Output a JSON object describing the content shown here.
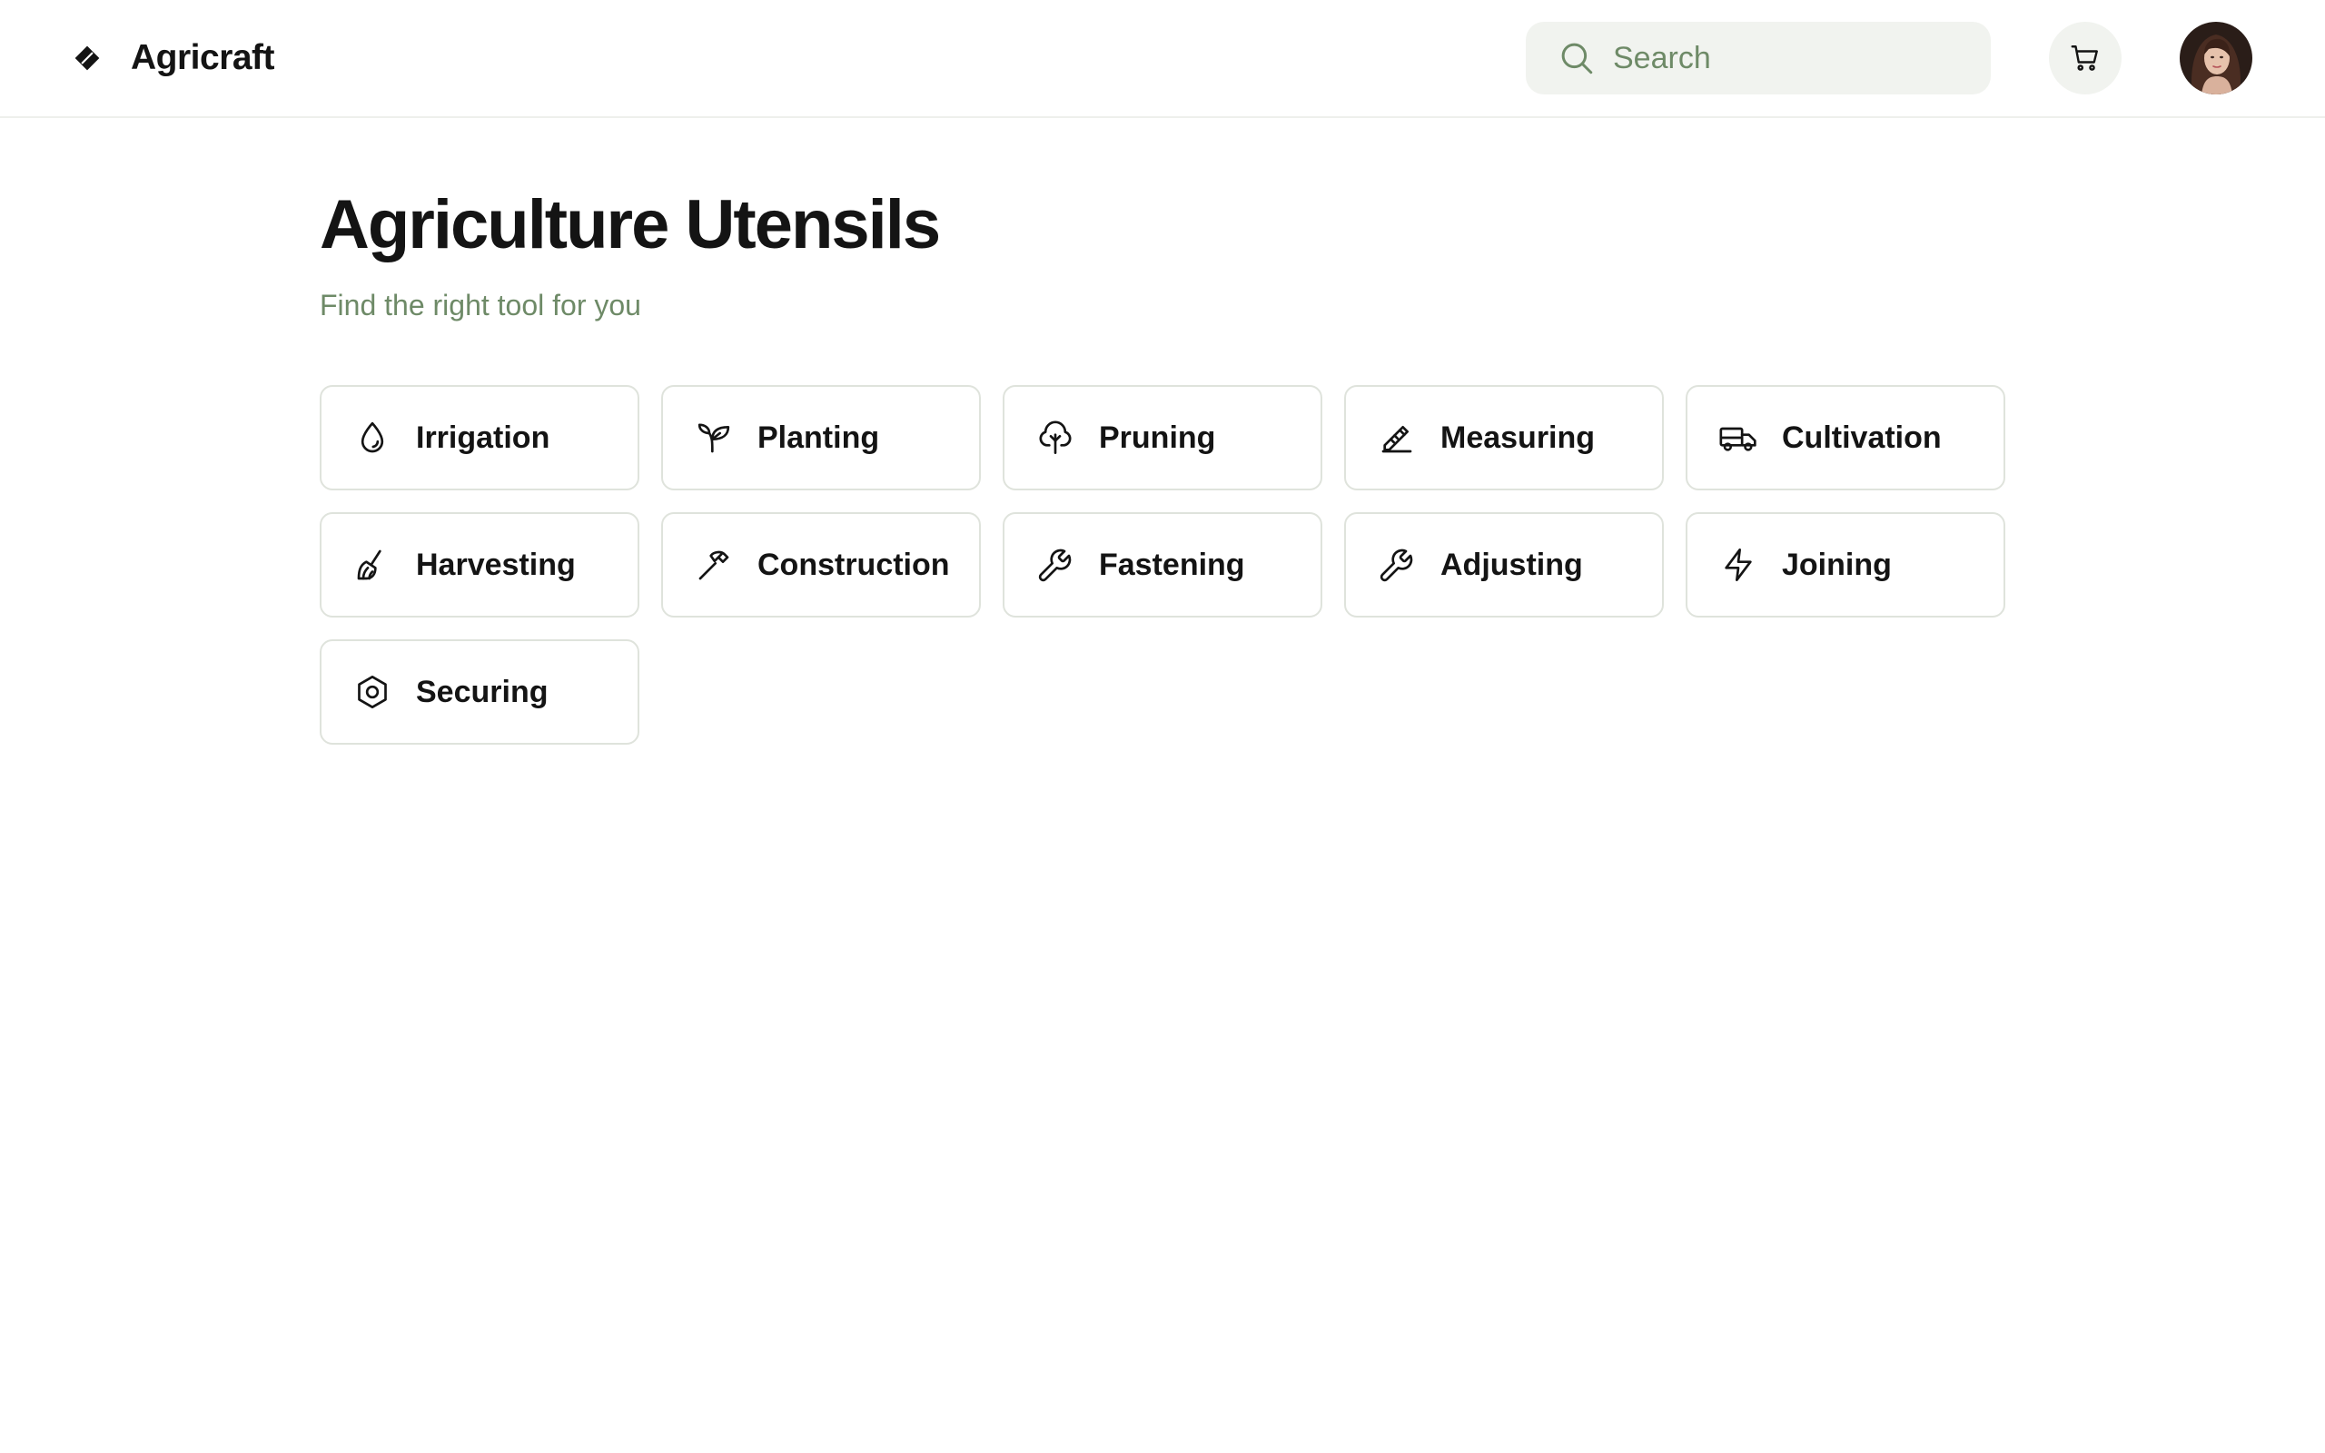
{
  "app": {
    "name": "Agricraft"
  },
  "header": {
    "search": {
      "placeholder": "Search"
    },
    "icons": {
      "brand": "leaf-diamond-icon",
      "search": "search-icon",
      "cart": "cart-icon"
    }
  },
  "page": {
    "title": "Agriculture Utensils",
    "subtitle": "Find the right tool for you"
  },
  "categories": [
    {
      "label": "Irrigation",
      "icon": "droplet-icon"
    },
    {
      "label": "Planting",
      "icon": "sprout-icon"
    },
    {
      "label": "Pruning",
      "icon": "tree-icon"
    },
    {
      "label": "Measuring",
      "icon": "pencil-ruler-icon"
    },
    {
      "label": "Cultivation",
      "icon": "truck-icon"
    },
    {
      "label": "Harvesting",
      "icon": "brush-icon"
    },
    {
      "label": "Construction",
      "icon": "hammer-icon"
    },
    {
      "label": "Fastening",
      "icon": "wrench-icon"
    },
    {
      "label": "Adjusting",
      "icon": "wrench-icon"
    },
    {
      "label": "Joining",
      "icon": "bolt-icon"
    },
    {
      "label": "Securing",
      "icon": "hex-nut-icon"
    }
  ],
  "colors": {
    "accent_muted": "#6e8a67",
    "surface": "#f1f3ef",
    "border": "#dfe3dc",
    "text": "#141414"
  }
}
